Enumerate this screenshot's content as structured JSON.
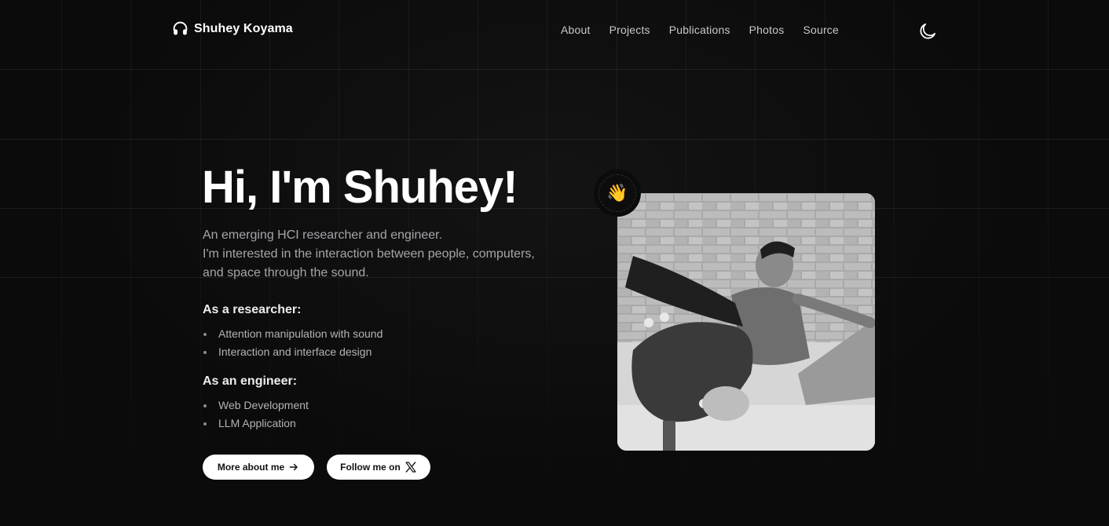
{
  "header": {
    "brand_name": "Shuhey Koyama",
    "nav": {
      "about": "About",
      "projects": "Projects",
      "publications": "Publications",
      "photos": "Photos",
      "source": "Source"
    }
  },
  "hero": {
    "title": "Hi, I'm Shuhey!",
    "intro_line1": "An emerging HCI researcher and engineer.",
    "intro_line2": "I'm interested in the interaction between people, computers,",
    "intro_line3": "and space through the sound.",
    "researcher": {
      "heading": "As a researcher:",
      "items": [
        "Attention manipulation with sound",
        "Interaction and interface design"
      ]
    },
    "engineer": {
      "heading": "As an engineer:",
      "items": [
        "Web Development",
        "LLM Application"
      ]
    },
    "buttons": {
      "more": "More about me",
      "follow": "Follow me on"
    },
    "wave_emoji": "👋"
  },
  "icons": {
    "brand": "headphones-icon",
    "theme": "moon-icon",
    "more": "arrow-right-icon",
    "follow": "x-logo-icon"
  },
  "colors": {
    "background": "#0b0b0c",
    "text_primary": "#ffffff",
    "text_muted": "#a6a6aa",
    "button_bg": "#ffffff"
  }
}
